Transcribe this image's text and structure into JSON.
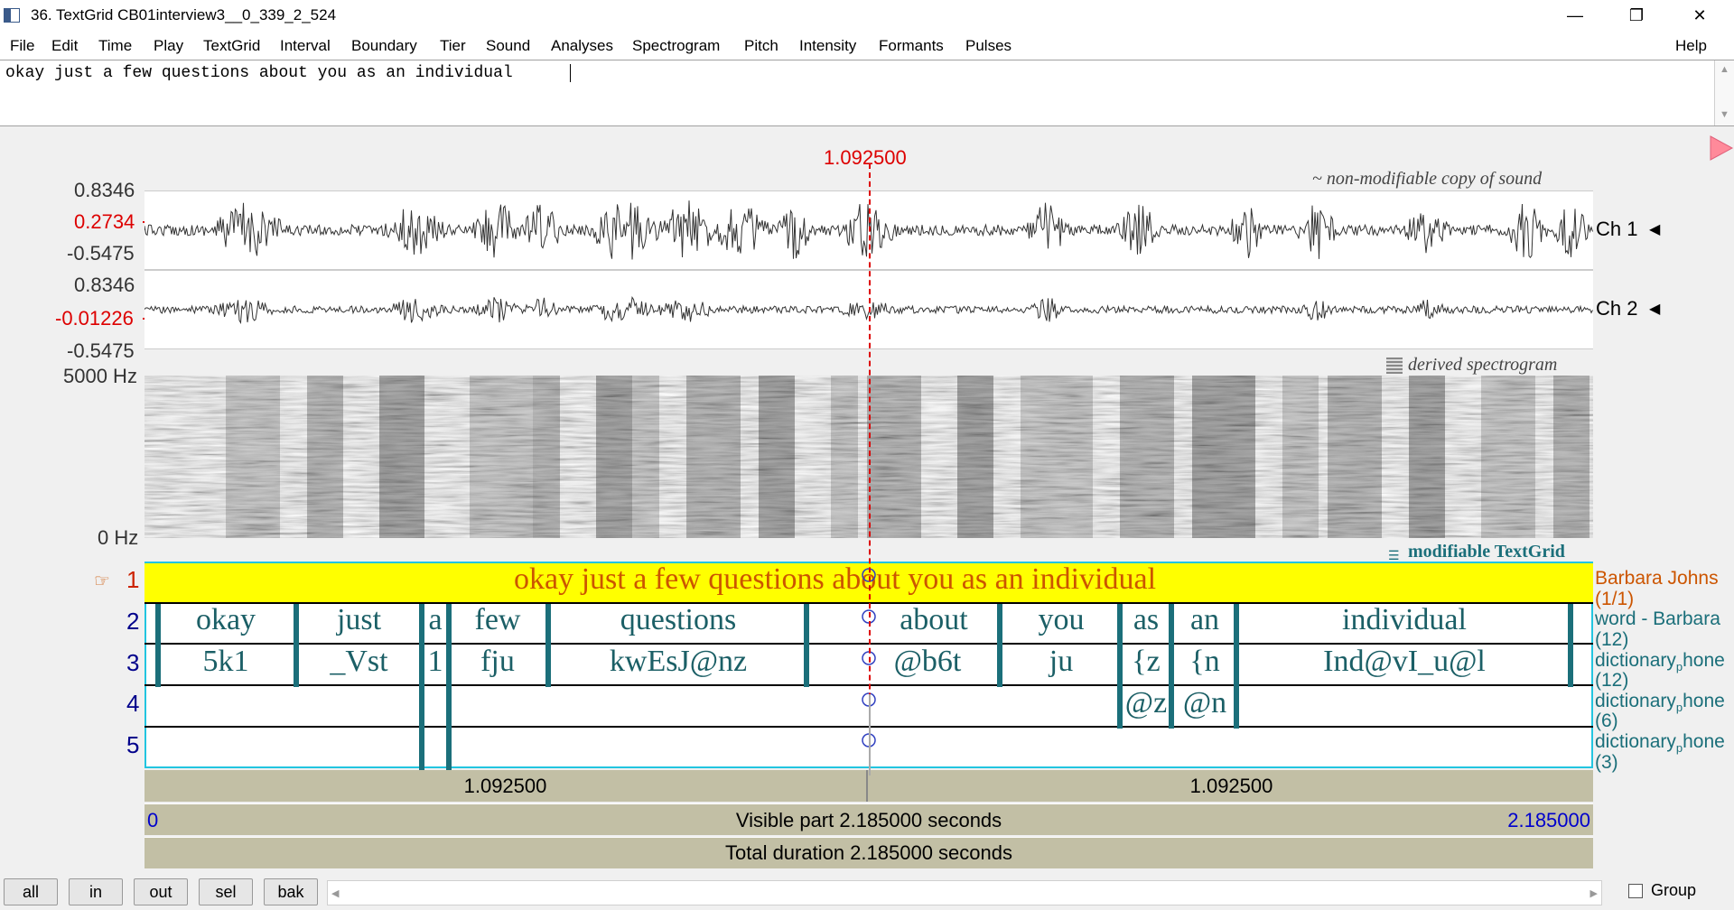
{
  "window": {
    "title": "36. TextGrid CB01interview3__0_339_2_524",
    "minimize_glyph": "—",
    "maximize_glyph": "❐",
    "close_glyph": "✕"
  },
  "menu": {
    "items": [
      "File",
      "Edit",
      "Time",
      "Play",
      "TextGrid",
      "Interval",
      "Boundary",
      "Tier",
      "Sound",
      "Analyses",
      "Spectrogram",
      "Pitch",
      "Intensity",
      "Formants",
      "Pulses"
    ],
    "help": "Help"
  },
  "editor": {
    "text": "okay just a few questions about you as an individual"
  },
  "cursor_time": "1.092500",
  "sound": {
    "note": "~ non-modifiable copy of sound",
    "ch1": {
      "top": "0.8346",
      "value": "0.2734",
      "bottom": "-0.5475",
      "label": "Ch 1"
    },
    "ch2": {
      "top": "0.8346",
      "value": "-0.01226",
      "bottom": "-0.5475",
      "label": "Ch 2"
    },
    "speaker_glyph": "◀"
  },
  "spectrogram": {
    "note": "derived spectrogram",
    "top": "5000 Hz",
    "bottom": "0 Hz"
  },
  "textgrid": {
    "note": "modifiable TextGrid",
    "pointer_glyph": "☞",
    "tier_numbers": [
      "1",
      "2",
      "3",
      "4",
      "5"
    ],
    "tier1_text": "okay just a few questions about you as an individual",
    "tier2_words": [
      "okay",
      "just",
      "a",
      "few",
      "questions",
      "about",
      "you",
      "as",
      "an",
      "individual"
    ],
    "tier3_phones": [
      "5k1",
      "_Vst",
      "1",
      "fju",
      "kwEsJ@nz",
      "@b6t",
      "ju",
      "{z",
      "{n",
      "Ind@vI_u@l"
    ],
    "tier4_phones": [
      "@z",
      "@n"
    ],
    "tier_labels": [
      {
        "name": "Barbara Johns",
        "count": "(1/1)"
      },
      {
        "name": "word - Barbara",
        "count": "(12)"
      },
      {
        "name": "dictionary",
        "sub": "p",
        "suffix": "hone",
        "count": "(12)"
      },
      {
        "name": "dictionary",
        "sub": "p",
        "suffix": "hone",
        "count": "(6)"
      },
      {
        "name": "dictionary",
        "sub": "p",
        "suffix": "hone",
        "count": "(3)"
      }
    ]
  },
  "time_bars": {
    "left_half": "1.092500",
    "right_half": "1.092500",
    "visible_start": "0",
    "visible_label": "Visible part 2.185000 seconds",
    "visible_end": "2.185000",
    "total_label": "Total duration 2.185000 seconds"
  },
  "buttons": [
    "all",
    "in",
    "out",
    "sel",
    "bak"
  ],
  "scroll_left_glyph": "◀",
  "scroll_right_glyph": "▶",
  "group_label": "Group",
  "colors": {
    "cursor_red": "#dd0000",
    "tier_text": "#1b6f7a",
    "selected_tier": "#ffff00",
    "time_bar": "#c2bfa5"
  }
}
